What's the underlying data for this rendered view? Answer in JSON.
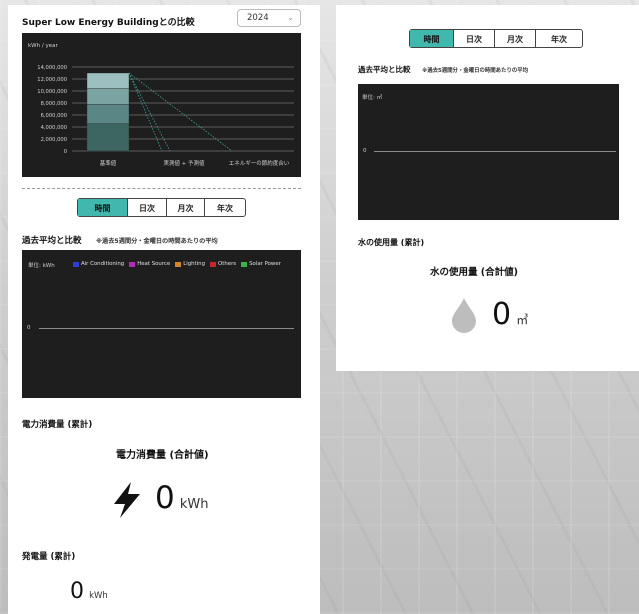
{
  "comparison": {
    "title": "Super Low Energy Buildingとの比較",
    "year": "2024",
    "chart": {
      "y_unit": "kWh / year",
      "y_ticks": [
        "14,000,000",
        "12,000,000",
        "10,000,000",
        "8,000,000",
        "6,000,000",
        "4,000,000",
        "2,000,000",
        "0"
      ],
      "x_labels": [
        "基準値",
        "実測値 + 予測値",
        "エネルギーの節約度合い"
      ]
    }
  },
  "chart_data": {
    "type": "bar",
    "categories": [
      "基準値",
      "実測値 + 予測値",
      "エネルギーの節約度合い"
    ],
    "values": [
      13000000,
      0,
      0
    ],
    "ylabel": "kWh / year",
    "ylim": [
      0,
      14000000
    ]
  },
  "left": {
    "tabs": [
      "時間",
      "日次",
      "月次",
      "年次"
    ],
    "active_tab": "時間",
    "avg_title": "過去平均と比較",
    "avg_note": "※過去5週間分・金曜日の時間あたりの平均",
    "chart_unit": "単位: kWh",
    "zero": "0",
    "legend": [
      {
        "label": "Air Conditioning",
        "color": "#2a3fd6"
      },
      {
        "label": "Heat Source",
        "color": "#b32ab8"
      },
      {
        "label": "Lighting",
        "color": "#d6862a"
      },
      {
        "label": "Others",
        "color": "#c9252c"
      },
      {
        "label": "Solar Power",
        "color": "#3ab44a"
      }
    ],
    "power_section_title": "電力消費量 (累計)",
    "power_card_title": "電力消費量 (合計値)",
    "power_value": "0",
    "power_unit": "kWh",
    "gen_section_title": "発電量 (累計)",
    "gen_value": "0",
    "gen_unit": "kWh"
  },
  "right": {
    "tabs": [
      "時間",
      "日次",
      "月次",
      "年次"
    ],
    "active_tab": "時間",
    "avg_title": "過去平均と比較",
    "avg_note": "※過去5週間分・金曜日の時間あたりの平均",
    "chart_unit": "単位: ㎥",
    "zero": "0",
    "water_section_title": "水の使用量 (累計)",
    "water_card_title": "水の使用量 (合計値)",
    "water_value": "0",
    "water_unit": "㎥"
  }
}
